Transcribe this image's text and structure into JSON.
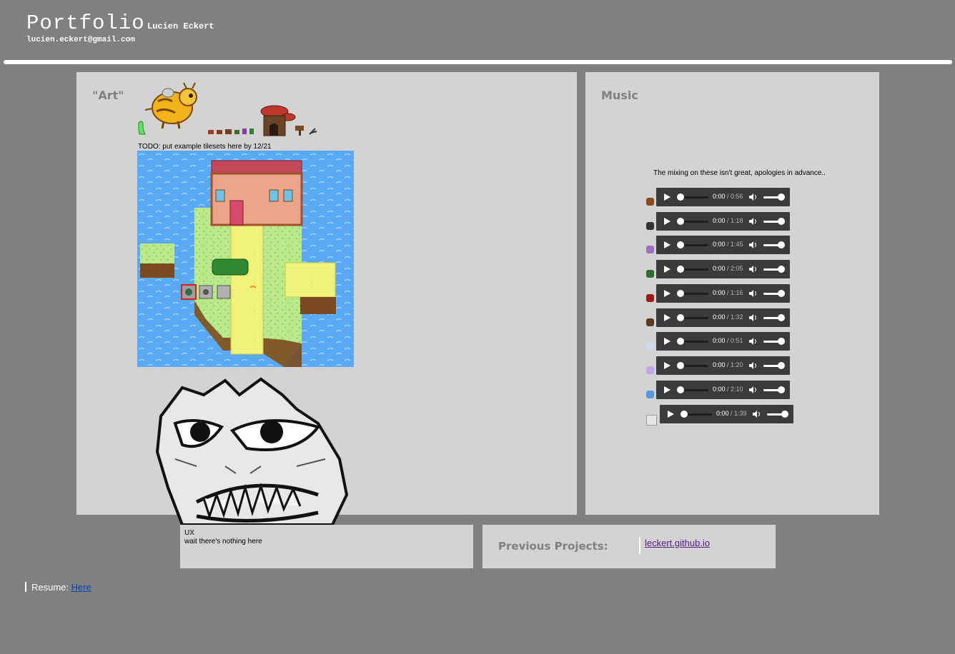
{
  "header": {
    "title": "Portfolio",
    "name": "Lucien Eckert",
    "email": "lucien.eckert@gmail.com"
  },
  "art": {
    "title": "\"Art\"",
    "todo": "TODO: put example tilesets here by 12/21"
  },
  "music": {
    "title": "Music",
    "note": "The mixing on these isn't great, apologies in advance..",
    "tracks": [
      {
        "icon": "poop-icon",
        "current": "0:00",
        "duration": "0:56"
      },
      {
        "icon": "clock-icon",
        "current": "0:00",
        "duration": "1:18"
      },
      {
        "icon": "mushroom-icon",
        "current": "0:00",
        "duration": "1:45"
      },
      {
        "icon": "frog-icon",
        "current": "0:00",
        "duration": "2:05"
      },
      {
        "icon": "red-creature-icon",
        "current": "0:00",
        "duration": "1:16"
      },
      {
        "icon": "magnifier-icon",
        "current": "0:00",
        "duration": "1:32"
      },
      {
        "icon": "faint-icon",
        "current": "0:00",
        "duration": "0:51"
      },
      {
        "icon": "purple-icon",
        "current": "0:00",
        "duration": "1:20"
      },
      {
        "icon": "flask-icon",
        "current": "0:00",
        "duration": "2:10"
      },
      {
        "icon": "broken-image-icon",
        "current": "0:00",
        "duration": "1:39"
      }
    ],
    "separator": " / "
  },
  "ux": {
    "title": "UX",
    "text": "wait there's nothing here"
  },
  "previous": {
    "title": "Previous Projects:",
    "link": "leckert.github.io"
  },
  "resume": {
    "label": "Resume: ",
    "link": "Here"
  }
}
